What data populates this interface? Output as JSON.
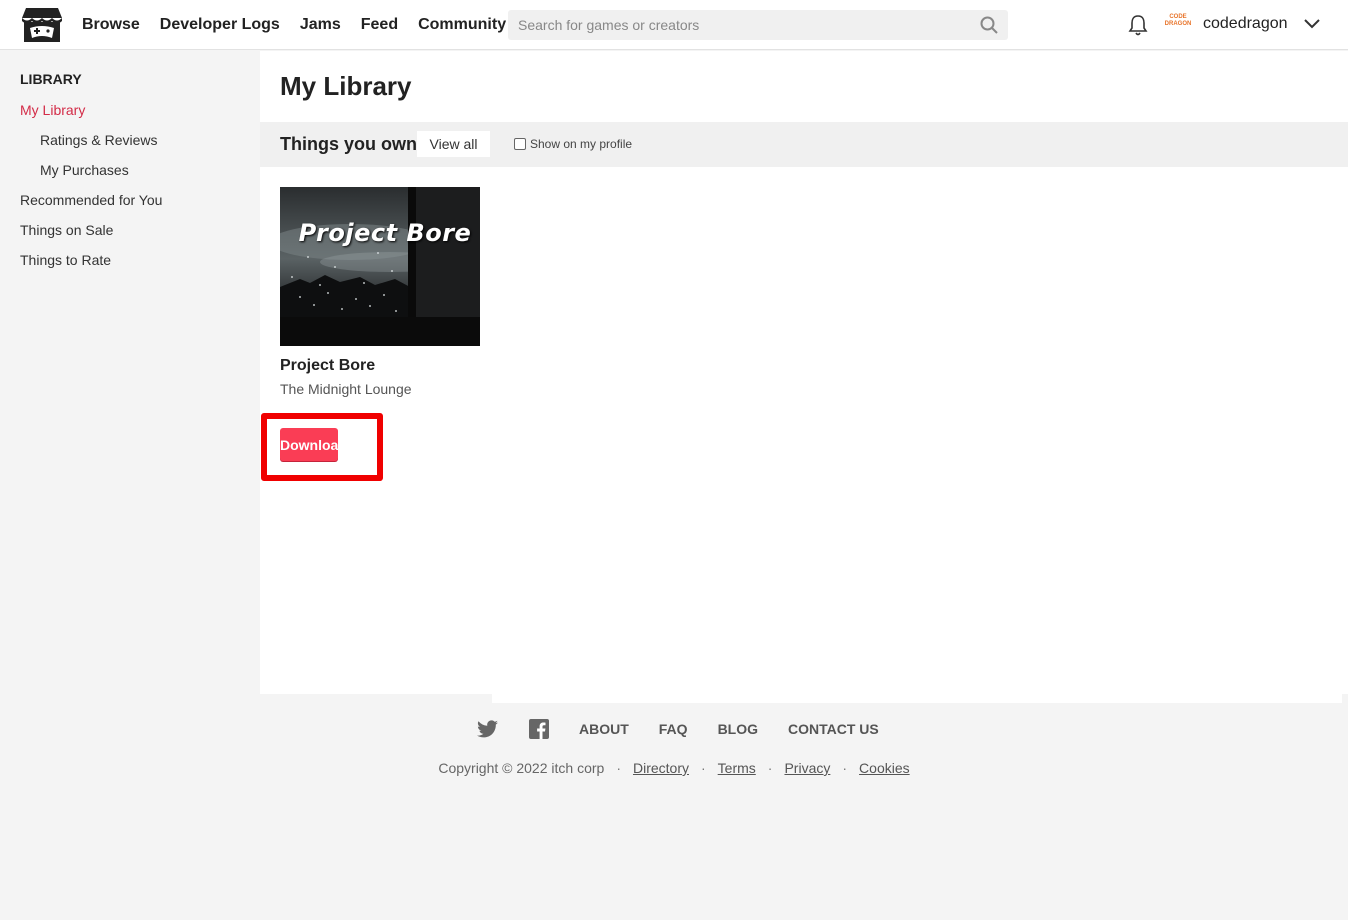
{
  "header": {
    "logo": "itchio-logo-icon",
    "nav": [
      "Browse",
      "Developer Logs",
      "Jams",
      "Feed",
      "Community"
    ],
    "search_placeholder": "Search for games or creators",
    "search_value": "",
    "username": "codedragon",
    "avatar_text": "CODE DRAGON"
  },
  "sidebar": {
    "heading": "LIBRARY",
    "items": [
      {
        "label": "My Library",
        "active": true
      },
      {
        "label": "Ratings & Reviews"
      },
      {
        "label": "My Purchases"
      },
      {
        "label": "Recommended for You"
      },
      {
        "label": "Things on Sale"
      },
      {
        "label": "Things to Rate"
      }
    ]
  },
  "main": {
    "title": "My Library",
    "section_title": "Things you own",
    "view_all": "View all",
    "show_on_profile": "Show on my profile",
    "show_on_profile_checked": false,
    "game": {
      "thumb_title": "Project Bore",
      "name": "Project Bore",
      "author": "The Midnight Lounge",
      "download_label": "Download"
    }
  },
  "footer": {
    "links": [
      "ABOUT",
      "FAQ",
      "BLOG",
      "CONTACT US"
    ],
    "copyright": "Copyright © 2022 itch corp",
    "legal_links": [
      "Directory",
      "Terms",
      "Privacy",
      "Cookies"
    ]
  },
  "colors": {
    "accent_active": "#d32c48",
    "download_button": "#fa3d55",
    "highlight_box": "#f00000"
  }
}
